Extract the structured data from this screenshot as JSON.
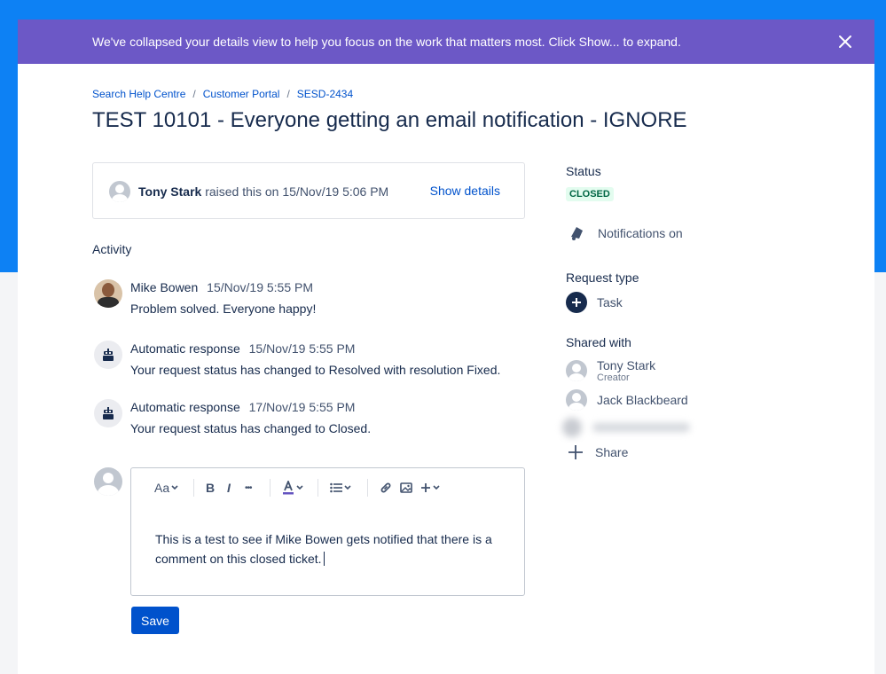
{
  "banner": {
    "message": "We've collapsed your details view to help you focus on the work that matters most. Click Show... to expand."
  },
  "breadcrumb": [
    "Search Help Centre",
    "Customer Portal",
    "SESD-2434"
  ],
  "title": "TEST 10101 - Everyone getting an email notification - IGNORE",
  "raised": {
    "name": "Tony Stark",
    "text": "raised this on 15/Nov/19 5:06 PM",
    "show_details": "Show details"
  },
  "activity": {
    "label": "Activity",
    "items": [
      {
        "author": "Mike Bowen",
        "time": "15/Nov/19 5:55 PM",
        "body": "Problem solved. Everyone happy!"
      },
      {
        "author": "Automatic response",
        "time": "15/Nov/19 5:55 PM",
        "body": "Your request status has changed to Resolved with resolution Fixed."
      },
      {
        "author": "Automatic response",
        "time": "17/Nov/19 5:55 PM",
        "body": "Your request status has changed to Closed."
      }
    ]
  },
  "editor": {
    "toolbar": {
      "text_style": "Aa",
      "bold": "B",
      "italic": "I",
      "more": "•••"
    },
    "content": "This is a test to see if Mike Bowen gets notified that there is a comment on this closed ticket."
  },
  "save_label": "Save",
  "sidebar": {
    "status_label": "Status",
    "status_value": "CLOSED",
    "notifications": "Notifications on",
    "request_type_label": "Request type",
    "request_type": "Task",
    "shared_with_label": "Shared with",
    "shared": [
      {
        "name": "Tony Stark",
        "role": "Creator"
      },
      {
        "name": "Jack Blackbeard",
        "role": ""
      }
    ],
    "share_label": "Share"
  },
  "colors": {
    "page_blue": "#0d81f4",
    "banner_purple": "#6c58c6",
    "link": "#0052cc",
    "status_green_bg": "#e3fcef",
    "status_green_text": "#006644"
  }
}
